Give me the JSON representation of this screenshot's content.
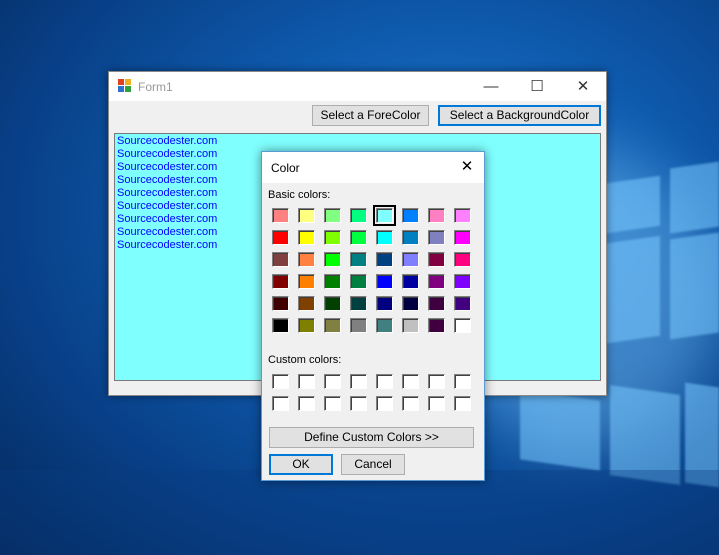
{
  "form": {
    "title": "Form1",
    "minimize": "—",
    "maximize": "☐",
    "close": "✕",
    "forecolor_button": "Select a ForeColor",
    "background_button": "Select a BackgroundColor",
    "textarea_background": "#80ffff",
    "text_color": "#0000ff",
    "lines": [
      "Sourcecodester.com",
      "Sourcecodester.com",
      "Sourcecodester.com",
      "Sourcecodester.com",
      "Sourcecodester.com",
      "Sourcecodester.com",
      "Sourcecodester.com",
      "Sourcecodester.com",
      "Sourcecodester.com"
    ]
  },
  "dialog": {
    "title": "Color",
    "close": "✕",
    "basic_colors_label": "Basic colors:",
    "custom_colors_label": "Custom colors:",
    "define_custom_button": "Define Custom Colors >>",
    "ok_button": "OK",
    "cancel_button": "Cancel",
    "selected_color": "#80ffff",
    "basic_colors": [
      [
        "#ff8080",
        "#ffff80",
        "#80ff80",
        "#00ff80",
        "#80ffff",
        "#0080ff",
        "#ff80c0",
        "#ff80ff"
      ],
      [
        "#ff0000",
        "#ffff00",
        "#80ff00",
        "#00ff40",
        "#00ffff",
        "#0080c0",
        "#8080c0",
        "#ff00ff"
      ],
      [
        "#804040",
        "#ff8040",
        "#00ff00",
        "#008080",
        "#004080",
        "#8080ff",
        "#800040",
        "#ff0080"
      ],
      [
        "#800000",
        "#ff8000",
        "#008000",
        "#008040",
        "#0000ff",
        "#0000a0",
        "#800080",
        "#8000ff"
      ],
      [
        "#400000",
        "#804000",
        "#004000",
        "#004040",
        "#000080",
        "#000040",
        "#400040",
        "#400080"
      ],
      [
        "#000000",
        "#808000",
        "#808040",
        "#808080",
        "#408080",
        "#c0c0c0",
        "#400040",
        "#ffffff"
      ]
    ]
  }
}
